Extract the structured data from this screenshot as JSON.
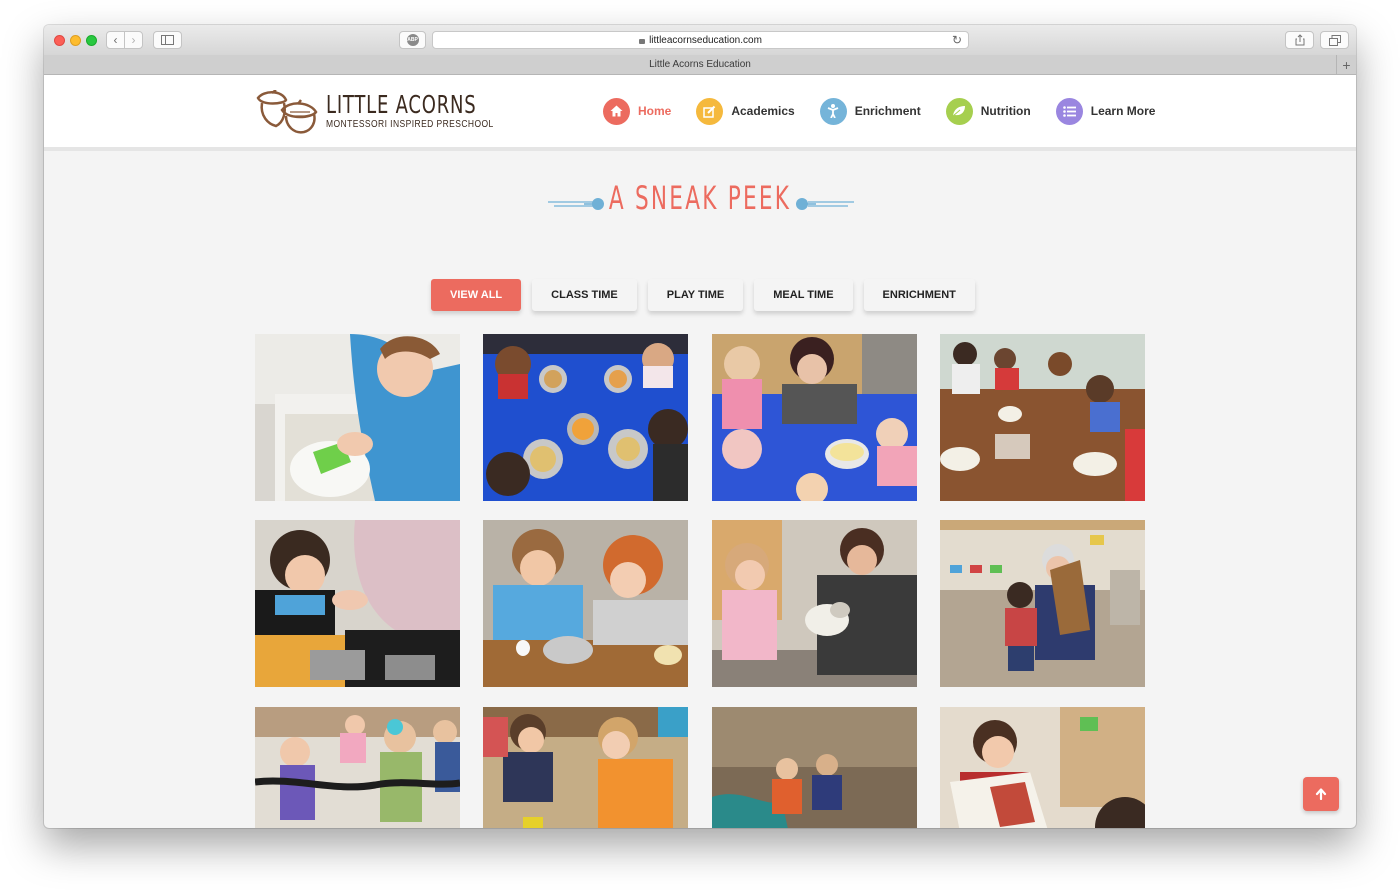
{
  "browser": {
    "url": "littleacornseducation.com",
    "tab_title": "Little Acorns Education",
    "adblock_badge": "ABP"
  },
  "site": {
    "logo_title": "LITTLE ACORNS",
    "logo_subtitle": "MONTESSORI INSPIRED PRESCHOOL",
    "nav": [
      {
        "label": "Home",
        "icon": "home-icon",
        "color": "#ec6b5f"
      },
      {
        "label": "Academics",
        "icon": "edit-icon",
        "color": "#f5b93d"
      },
      {
        "label": "Enrichment",
        "icon": "child-icon",
        "color": "#75b4d9"
      },
      {
        "label": "Nutrition",
        "icon": "leaf-icon",
        "color": "#a6cf4f"
      },
      {
        "label": "Learn More",
        "icon": "list-icon",
        "color": "#9a86e0"
      }
    ]
  },
  "section": {
    "title": "A SNEAK PEEK"
  },
  "filters": [
    "VIEW ALL",
    "CLASS TIME",
    "PLAY TIME",
    "MEAL TIME",
    "ENRICHMENT"
  ],
  "colors": {
    "accent": "#ec6b5f",
    "heading_ornament": "#6fb0d6"
  },
  "gallery": {
    "photos": [
      {
        "name": "photo-child-washing-plate"
      },
      {
        "name": "photo-children-blue-table-meal"
      },
      {
        "name": "photo-teacher-mixing-bowl"
      },
      {
        "name": "photo-children-wood-table-meal"
      },
      {
        "name": "photo-child-watching-hands"
      },
      {
        "name": "photo-boys-cooking-eggs"
      },
      {
        "name": "photo-child-petting-rabbit"
      },
      {
        "name": "photo-child-with-grandmother-harp"
      },
      {
        "name": "photo-children-playing-rope"
      },
      {
        "name": "photo-boys-sandbox"
      },
      {
        "name": "photo-girls-outdoor-slide"
      },
      {
        "name": "photo-boy-reading-book"
      }
    ]
  }
}
